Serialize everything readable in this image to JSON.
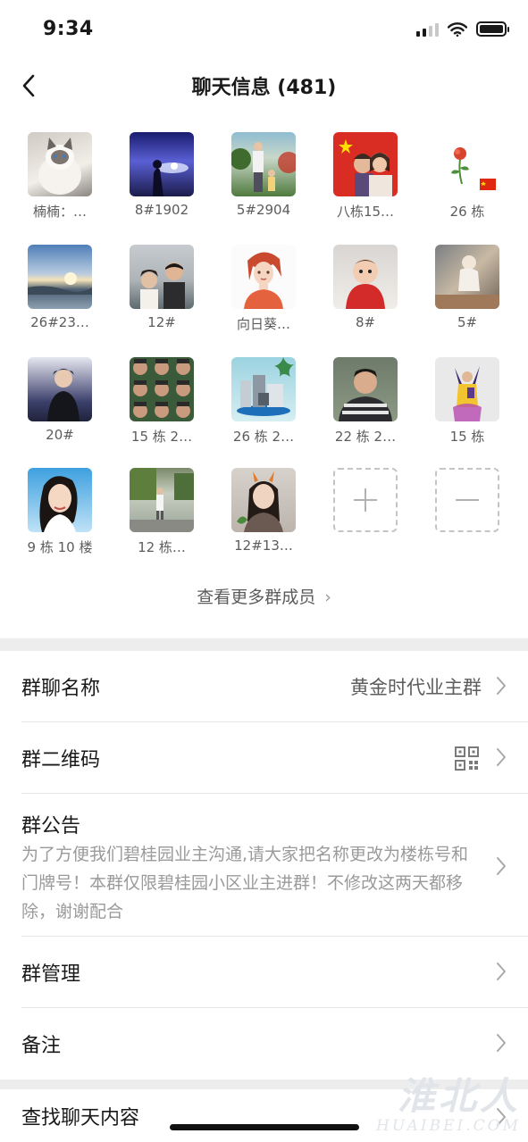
{
  "status_bar": {
    "time": "9:34"
  },
  "nav": {
    "title": "聊天信息 (481)"
  },
  "members": [
    {
      "name": "楠楠：…"
    },
    {
      "name": "8#1902"
    },
    {
      "name": "5#2904"
    },
    {
      "name": "八栋15…"
    },
    {
      "name": "26 栋"
    },
    {
      "name": "26#23…"
    },
    {
      "name": "12#"
    },
    {
      "name": "向日葵…"
    },
    {
      "name": "8#"
    },
    {
      "name": "5#"
    },
    {
      "name": "20#"
    },
    {
      "name": "15 栋 2…"
    },
    {
      "name": "26 栋 2…"
    },
    {
      "name": "22 栋 2…"
    },
    {
      "name": "15 栋"
    },
    {
      "name": "9 栋 10 楼"
    },
    {
      "name": "12 栋…"
    },
    {
      "name": "12#13…"
    }
  ],
  "actions": {
    "add": "+",
    "remove": "—"
  },
  "more_members": "查看更多群成员",
  "settings": {
    "group_name_label": "群聊名称",
    "group_name_value": "黄金时代业主群",
    "qr_label": "群二维码",
    "notice_label": "群公告",
    "notice_text": "为了方便我们碧桂园业主沟通,请大家把名称更改为楼栋号和门牌号！本群仅限碧桂园小区业主进群！不修改这两天都移除，谢谢配合",
    "manage_label": "群管理",
    "remark_label": "备注",
    "search_label": "查找聊天内容"
  },
  "watermark": {
    "cn": "淮北人",
    "en": "HUAIBEI.COM"
  }
}
